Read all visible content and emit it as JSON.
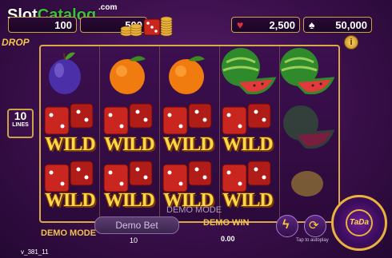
{
  "watermark": {
    "slot": "Slot",
    "catalog": "Catalog",
    "com": ".com"
  },
  "top": {
    "counter_left": "100",
    "counter_mid": "500",
    "counter_hearts": "2,500",
    "counter_spades": "50,000"
  },
  "drop_label": "DROP",
  "info_label": "i",
  "lines": {
    "number": "10",
    "label": "LINES"
  },
  "reels": [
    [
      "plum",
      "wild",
      "wild"
    ],
    [
      "orange",
      "wild",
      "wild"
    ],
    [
      "orange",
      "wild",
      "wild"
    ],
    [
      "watermelon",
      "wild",
      "wild"
    ],
    [
      "watermelon",
      "watermelon",
      "lemon"
    ]
  ],
  "wild_text": "WILD",
  "bottom": {
    "demo_mode": "DEMO MODE",
    "bet_label": "Demo Bet",
    "bet_value": "10",
    "demo_mode_overlay": "DEMO MODE",
    "demo_win": "DEMO WIN",
    "win_value": "0.00",
    "autoplay_hint": "Tap to autoplay",
    "spin_label": "TaDa",
    "version": "v_381_11"
  },
  "colors": {
    "gold": "#f2c14e",
    "purple_bg": "#3a0f4a",
    "frame": "#d8a84a"
  }
}
